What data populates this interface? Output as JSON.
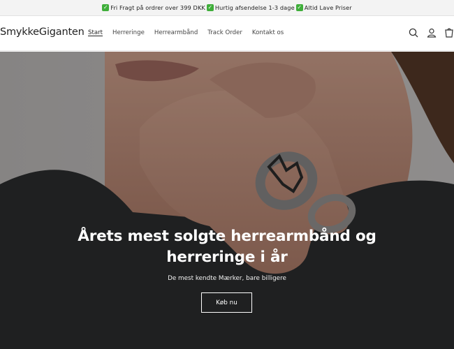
{
  "announcement": {
    "items": [
      "Fri Fragt på ordrer over 399 DKK",
      "Hurtig afsendelse 1-3 dage",
      "Altid Lave Priser"
    ],
    "check_color": "#3fae3a"
  },
  "header": {
    "logo": "SmykkeGiganten",
    "nav": [
      {
        "label": "Start",
        "active": true
      },
      {
        "label": "Herreringe"
      },
      {
        "label": "Herrearmbånd"
      },
      {
        "label": "Track Order"
      },
      {
        "label": "Kontakt os"
      }
    ],
    "icons": [
      "search-icon",
      "account-icon",
      "cart-icon"
    ]
  },
  "hero": {
    "title": "Årets mest solgte herrearmbånd og herreringe i år",
    "subtitle": "De mest kendte Mærker, bare billigere",
    "button_label": "Køb nu",
    "image": "man-wearing-rings-photo"
  }
}
